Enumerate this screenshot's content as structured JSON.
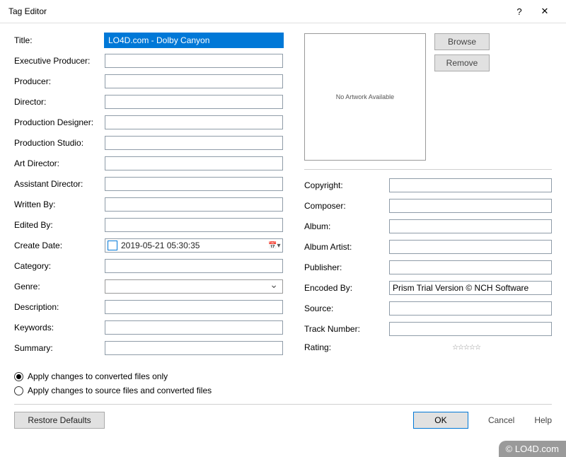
{
  "window": {
    "title": "Tag Editor",
    "help": "?",
    "close": "✕"
  },
  "leftFields": {
    "title": {
      "label": "Title:",
      "value": "LO4D.com - Dolby Canyon"
    },
    "execProducer": {
      "label": "Executive Producer:",
      "value": ""
    },
    "producer": {
      "label": "Producer:",
      "value": ""
    },
    "director": {
      "label": "Director:",
      "value": ""
    },
    "prodDesigner": {
      "label": "Production Designer:",
      "value": ""
    },
    "prodStudio": {
      "label": "Production Studio:",
      "value": ""
    },
    "artDirector": {
      "label": "Art Director:",
      "value": ""
    },
    "asstDirector": {
      "label": "Assistant Director:",
      "value": ""
    },
    "writtenBy": {
      "label": "Written By:",
      "value": ""
    },
    "editedBy": {
      "label": "Edited By:",
      "value": ""
    },
    "createDate": {
      "label": "Create Date:",
      "value": "2019-05-21 05:30:35"
    },
    "category": {
      "label": "Category:",
      "value": ""
    },
    "genre": {
      "label": "Genre:",
      "value": ""
    },
    "description": {
      "label": "Description:",
      "value": ""
    },
    "keywords": {
      "label": "Keywords:",
      "value": ""
    },
    "summary": {
      "label": "Summary:",
      "value": ""
    }
  },
  "artwork": {
    "placeholder": "No Artwork Available",
    "browse": "Browse",
    "remove": "Remove"
  },
  "rightFields": {
    "copyright": {
      "label": "Copyright:",
      "value": ""
    },
    "composer": {
      "label": "Composer:",
      "value": ""
    },
    "album": {
      "label": "Album:",
      "value": ""
    },
    "albumArtist": {
      "label": "Album Artist:",
      "value": ""
    },
    "publisher": {
      "label": "Publisher:",
      "value": ""
    },
    "encodedBy": {
      "label": "Encoded By:",
      "value": "Prism Trial Version © NCH Software"
    },
    "source": {
      "label": "Source:",
      "value": ""
    },
    "trackNumber": {
      "label": "Track Number:",
      "value": ""
    },
    "rating": {
      "label": "Rating:",
      "stars": "☆☆☆☆☆"
    }
  },
  "radios": {
    "opt1": "Apply changes to converted files only",
    "opt2": "Apply changes to source files and converted files"
  },
  "bottom": {
    "restore": "Restore Defaults",
    "ok": "OK",
    "cancel": "Cancel",
    "help": "Help"
  },
  "watermark": "© LO4D.com"
}
